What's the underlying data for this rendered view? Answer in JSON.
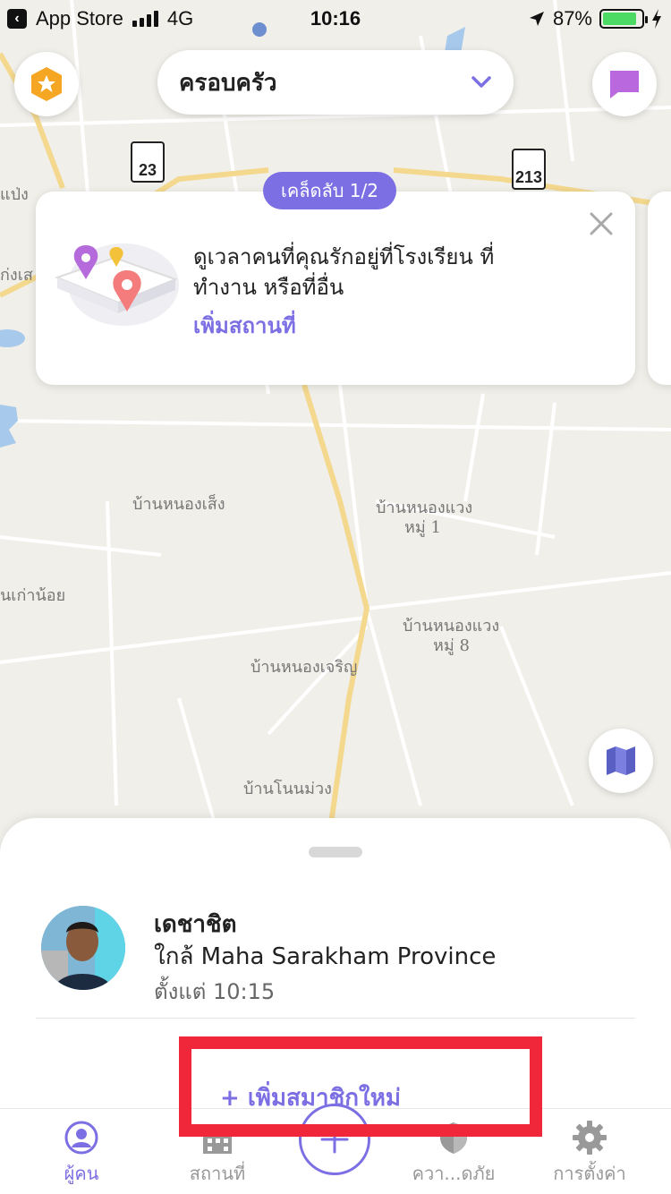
{
  "status_bar": {
    "back_app": "App Store",
    "network": "4G",
    "time": "10:16",
    "battery": "87%",
    "battery_level": 0.87
  },
  "header": {
    "group_name": "ครอบครัว",
    "premium_icon": "star-badge-icon",
    "chat_icon": "chat-bubble-icon"
  },
  "map": {
    "road_shields": [
      "23",
      "213"
    ],
    "labels": [
      "แป่ง",
      "ก่งเส",
      "บ้านหนองเส็ง",
      "บ้านหนองแวง",
      "หมู่ 1",
      "นเก่าน้อย",
      "บ้านหนองแวง",
      "หมู่ 8",
      "บ้านหนองเจริญ",
      "บ้านโนนม่วง"
    ]
  },
  "tip": {
    "badge": "เคล็ดลับ 1/2",
    "text": "ดูเวลาคนที่คุณรักอยู่ที่โรงเรียน ที่ทำงาน หรือที่อื่น",
    "link": "เพิ่มสถานที่"
  },
  "member": {
    "name": "เดชาชิต",
    "location": "ใกล้ Maha Sarakham Province",
    "since": "ตั้งแต่ 10:15"
  },
  "add_member": "+ เพิ่มสมาชิกใหม่",
  "tabs": [
    {
      "label": "ผู้คน",
      "icon": "person-icon",
      "active": true
    },
    {
      "label": "สถานที่",
      "icon": "building-icon",
      "active": false
    },
    {
      "label": "",
      "icon": "plus-icon",
      "active": false
    },
    {
      "label": "ควา...ดภัย",
      "icon": "shield-icon",
      "active": false
    },
    {
      "label": "การตั้งค่า",
      "icon": "gear-icon",
      "active": false
    }
  ],
  "colors": {
    "accent": "#7c6fe3",
    "highlight": "#f0263b",
    "premium": "#f5a623",
    "map_bg": "#f1efe9",
    "road_major": "#f3d88e"
  }
}
